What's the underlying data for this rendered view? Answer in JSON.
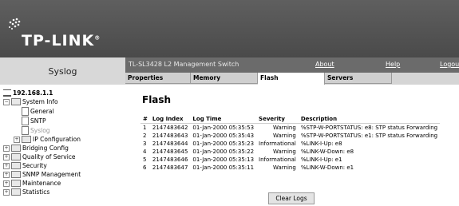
{
  "brand": {
    "logo_text": "TP-LINK",
    "logo_mark": "®"
  },
  "header": {
    "section_title": "Syslog",
    "app_title": "TL-SL3428 L2 Management Switch",
    "links": [
      "About",
      "Help",
      "Logout"
    ]
  },
  "tabs": [
    "Properties",
    "Memory",
    "Flash",
    "Servers"
  ],
  "active_tab": "Flash",
  "sidebar": {
    "root": "192.168.1.1",
    "items": [
      {
        "label": "System Info",
        "expand": "−"
      },
      {
        "label": "General"
      },
      {
        "label": "SNTP"
      },
      {
        "label": "Syslog"
      },
      {
        "label": "IP Configuration",
        "expand": "+"
      },
      {
        "label": "Bridging Config",
        "expand": "+"
      },
      {
        "label": "Quality of Service",
        "expand": "+"
      },
      {
        "label": "Security",
        "expand": "+"
      },
      {
        "label": "SNMP Management",
        "expand": "+"
      },
      {
        "label": "Maintenance",
        "expand": "+"
      },
      {
        "label": "Statistics",
        "expand": "+"
      }
    ]
  },
  "main": {
    "title": "Flash",
    "columns": [
      "#",
      "Log Index",
      "Log Time",
      "Severity",
      "Description"
    ],
    "rows": [
      [
        "1",
        "2147483642",
        "01-Jan-2000 05:35:53",
        "Warning",
        "%STP-W-PORTSTATUS: e8: STP status Forwarding"
      ],
      [
        "2",
        "2147483643",
        "01-Jan-2000 05:35:43",
        "Warning",
        "%STP-W-PORTSTATUS: e1: STP status Forwarding"
      ],
      [
        "3",
        "2147483644",
        "01-Jan-2000 05:35:23",
        "Informational",
        "%LINK-I-Up: e8"
      ],
      [
        "4",
        "2147483645",
        "01-Jan-2000 05:35:22",
        "Warning",
        "%LINK-W-Down: e8"
      ],
      [
        "5",
        "2147483646",
        "01-Jan-2000 05:35:13",
        "Informational",
        "%LINK-I-Up: e1"
      ],
      [
        "6",
        "2147483647",
        "01-Jan-2000 05:35:11",
        "Warning",
        "%LINK-W-Down: e1"
      ]
    ],
    "clear_button": "Clear Logs"
  }
}
